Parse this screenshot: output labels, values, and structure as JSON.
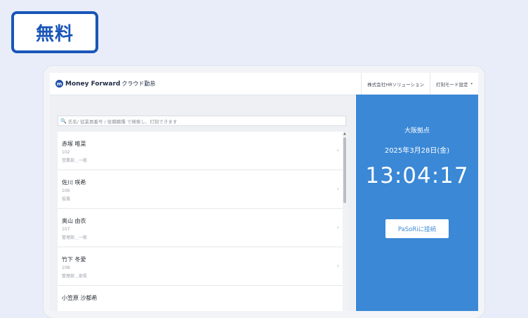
{
  "badge": {
    "label": "無料"
  },
  "header": {
    "logo_mark": "m",
    "logo_text": "Money Forward",
    "logo_sub": "クラウド勤怠",
    "company": "株式会社HRソリューション",
    "mode_setting": "打刻モード設定",
    "caret": "▾"
  },
  "search": {
    "icon": "🔍",
    "placeholder": "氏名/ 従業員番号 / 役職職種 で検索し、打刻できます"
  },
  "employees": [
    {
      "name": "赤塚 唯菜",
      "code": "102",
      "dept": "営業部＿一般"
    },
    {
      "name": "佐川 咲希",
      "code": "106",
      "dept": "役員"
    },
    {
      "name": "奥山 由衣",
      "code": "107",
      "dept": "管理部＿一般"
    },
    {
      "name": "竹下 冬愛",
      "code": "108",
      "dept": "管理部＿部長"
    },
    {
      "name": "小笠原 沙都希",
      "code": "",
      "dept": ""
    }
  ],
  "clock": {
    "location": "大阪拠点",
    "date": "2025年3月28日(金)",
    "time": "13:04:17",
    "connect_button": "PaSoRiに接続"
  },
  "colors": {
    "accent": "#3a88d6",
    "badge": "#1a56b8",
    "background": "#e8edf9"
  }
}
